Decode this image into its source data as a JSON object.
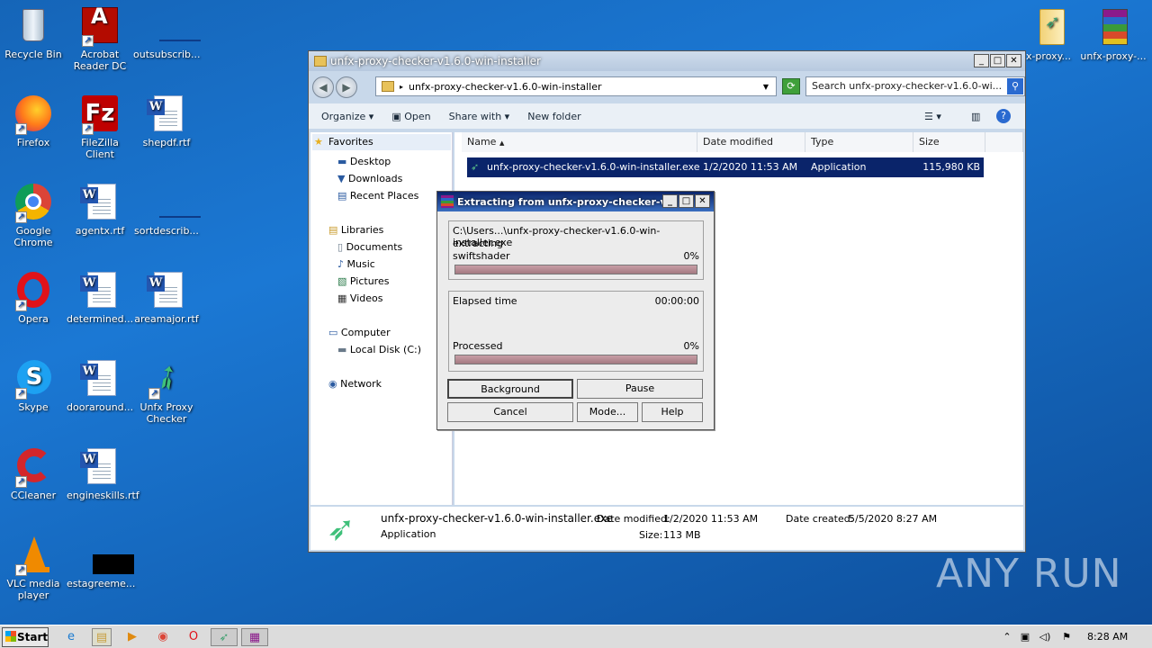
{
  "desktop_icons": [
    {
      "label": "Recycle Bin",
      "icon": "recycle-bin-icon"
    },
    {
      "label": "Acrobat Reader DC",
      "icon": "acrobat-icon"
    },
    {
      "label": "outsubscrib...",
      "icon": "blank-file-icon"
    },
    {
      "label": "Firefox",
      "icon": "firefox-icon"
    },
    {
      "label": "FileZilla Client",
      "icon": "filezilla-icon"
    },
    {
      "label": "shepdf.rtf",
      "icon": "word-doc-icon"
    },
    {
      "label": "Google Chrome",
      "icon": "chrome-icon"
    },
    {
      "label": "agentx.rtf",
      "icon": "word-doc-icon"
    },
    {
      "label": "sortdescrib...",
      "icon": "blank-file-icon"
    },
    {
      "label": "Opera",
      "icon": "opera-icon"
    },
    {
      "label": "determined...",
      "icon": "word-doc-icon"
    },
    {
      "label": "areamajor.rtf",
      "icon": "word-doc-icon"
    },
    {
      "label": "Skype",
      "icon": "skype-icon"
    },
    {
      "label": "dooraround...",
      "icon": "word-doc-icon"
    },
    {
      "label": "Unfx Proxy Checker",
      "icon": "rocket-icon"
    },
    {
      "label": "CCleaner",
      "icon": "ccleaner-icon"
    },
    {
      "label": "engineskills.rtf",
      "icon": "word-doc-icon"
    },
    {
      "label": "VLC media player",
      "icon": "vlc-icon"
    },
    {
      "label": "estagreeme...",
      "icon": "black-file-icon"
    },
    {
      "label": "x-proxy...",
      "icon": "folder-icon"
    },
    {
      "label": "unfx-proxy-...",
      "icon": "winrar-icon"
    }
  ],
  "explorer": {
    "title": "unfx-proxy-checker-v1.6.0-win-installer",
    "address": "unfx-proxy-checker-v1.6.0-win-installer",
    "search_placeholder": "Search unfx-proxy-checker-v1.6.0-wi...",
    "toolbar": {
      "organize": "Organize",
      "open": "Open",
      "share": "Share with",
      "new_folder": "New folder"
    },
    "nav": {
      "favorites": "Favorites",
      "desktop": "Desktop",
      "downloads": "Downloads",
      "recent": "Recent Places",
      "libraries": "Libraries",
      "documents": "Documents",
      "music": "Music",
      "pictures": "Pictures",
      "videos": "Videos",
      "computer": "Computer",
      "local_disk": "Local Disk (C:)",
      "network": "Network"
    },
    "columns": {
      "name": "Name",
      "date": "Date modified",
      "type": "Type",
      "size": "Size"
    },
    "file": {
      "name": "unfx-proxy-checker-v1.6.0-win-installer.exe",
      "date": "1/2/2020 11:53 AM",
      "type": "Application",
      "size": "115,980 KB"
    },
    "details": {
      "name": "unfx-proxy-checker-v1.6.0-win-installer.exe",
      "type": "Application",
      "modified_label": "Date modified:",
      "modified": "1/2/2020 11:53 AM",
      "created_label": "Date created:",
      "created": "5/5/2020 8:27 AM",
      "size_label": "Size:",
      "size": "113 MB"
    }
  },
  "dialog": {
    "title": "Extracting from unfx-proxy-checker-v...",
    "path": "C:\\Users...\\unfx-proxy-checker-v1.6.0-win-installer.exe",
    "status": "extracting",
    "current": "swiftshader",
    "current_pct": "0%",
    "elapsed_label": "Elapsed time",
    "elapsed": "00:00:00",
    "processed_label": "Processed",
    "processed_pct": "0%",
    "progress_fraction": 0,
    "buttons": {
      "background": "Background",
      "pause": "Pause",
      "cancel": "Cancel",
      "mode": "Mode...",
      "help": "Help"
    }
  },
  "taskbar": {
    "start": "Start",
    "time": "8:28 AM"
  },
  "watermark": "ANY RUN"
}
